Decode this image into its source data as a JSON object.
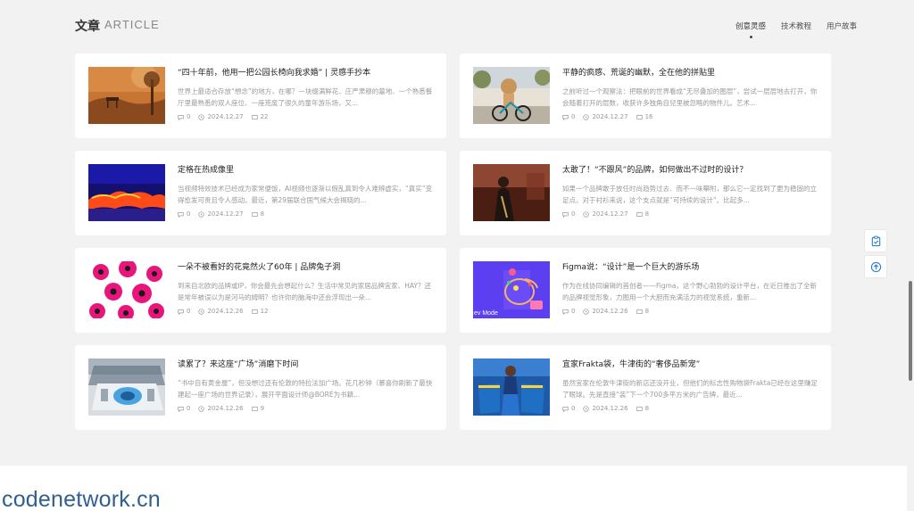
{
  "header": {
    "title_cn": "文章",
    "title_en": "ARTICLE"
  },
  "tabs": [
    {
      "label": "创意灵感",
      "active": true
    },
    {
      "label": "技术教程",
      "active": false
    },
    {
      "label": "用户故事",
      "active": false
    }
  ],
  "articles": [
    {
      "title": "“四十年前，他用一把公园长椅向我求婚” | 灵感手抄本",
      "excerpt": "世界上最适合存放“想念”的地方，在哪？一块缀满鲜花、庄严肃穆的墓地、一个熟悉餐厅里最熟悉的双人座位、一座荒废了很久的童年游乐场，又...",
      "comments": "0",
      "date": "2024.12.27",
      "views": "22"
    },
    {
      "title": "平静的疯感、荒诞的幽默，全在他的拼贴里",
      "excerpt": "之前听过一个观察法：把眼前的世界看成“无尽叠加的图层”，尝试一层层地去打开，你会随着打开的层数，收获许多独角自兒里被忽略的物件儿。艺术...",
      "comments": "0",
      "date": "2024.12.27",
      "views": "16"
    },
    {
      "title": "定格在热成像里",
      "excerpt": "当视频特效技术已经成为家常便饭，AI视频也逐渐以假乱真到令人难辨虚实，“真实”变得愈发可贵且令人感动。最近，第29届联合国气候大会揭晓的...",
      "comments": "0",
      "date": "2024.12.27",
      "views": "8"
    },
    {
      "title": "太敢了！“不跟风”的品牌，如何做出不过时的设计？",
      "excerpt": "如果一个品牌敢于放任时尚趋势过去、而不一味攀附，那么它一定找到了更为稳固的立足点。对于衬衫来说，这个支点就是“可持续的设计”。比起多...",
      "comments": "0",
      "date": "2024.12.27",
      "views": "8"
    },
    {
      "title": "一朵不被看好的花竟然火了60年 | 品牌兔子洞",
      "excerpt": "到来自北欧的品牌或IP，你会最先会想起什么？生活中常见的家居品牌宜家、HAY？还是常年被误以为是河马的姆明？也许你的脑海中还会浮现出一朵...",
      "comments": "0",
      "date": "2024.12.26",
      "views": "12"
    },
    {
      "title": "Figma说：“设计”是一个巨大的游乐场",
      "excerpt": "作为在线协同编辑的首创者——Figma，这个野心勃勃的设计平台，在近日推出了全新的品牌视觉形象，力图用一个大胆而充满活力的视觉系统，重新...",
      "comments": "0",
      "date": "2024.12.26",
      "views": "8"
    },
    {
      "title": "读累了？来这座“广场”消磨下时间",
      "excerpt": "“书中自有黄金屋”，但没想过还有伦敦的特拉法加广场。花几秒钟（慕喜你刷新了最快建起一座广场的世界记录），展开平面设计师@BORÉ为书籍...",
      "comments": "0",
      "date": "2024.12.26",
      "views": "9"
    },
    {
      "title": "宜家Frakta袋，牛津街的“奢侈品新宠”",
      "excerpt": "虽然宜家在伦敦牛津街的新店还没开业，但他们的标志性购物袋Frakta已经在这里赚足了眼球。先是直接“装”下一个700多平方米的广告牌，最近...",
      "comments": "0",
      "date": "2024.12.26",
      "views": "8"
    }
  ],
  "thumb_caption_figma": "ev Mode",
  "icons": {
    "comment": "comment-icon",
    "clock": "clock-icon",
    "views": "views-icon",
    "clipboard": "clipboard-icon",
    "back_to_top": "arrow-up-icon"
  },
  "watermark": "codenetwork.cn",
  "colors": {
    "background": "#f2f2f2",
    "card": "#ffffff",
    "figma_purple": "#5b3ff0",
    "ikea_blue": "#1f6fc4"
  }
}
